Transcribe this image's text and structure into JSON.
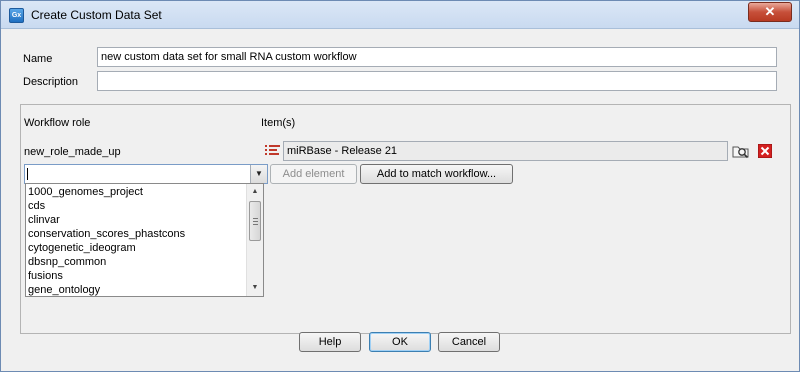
{
  "window": {
    "title": "Create Custom Data Set",
    "app_icon_text": "Gx",
    "close_symbol": "✕"
  },
  "form": {
    "name_label": "Name",
    "name_value": "new custom data set for small RNA custom workflow",
    "description_label": "Description",
    "description_value": ""
  },
  "roles": {
    "header_role": "Workflow role",
    "header_items": "Item(s)",
    "row": {
      "role": "new_role_made_up",
      "item": "miRBase - Release 21",
      "item_icon": "sequence-list-icon",
      "browse_icon": "browse-folder-icon",
      "remove_icon": "remove-icon",
      "remove_color": "#d42020"
    },
    "new_role_value": "",
    "add_element_label": "Add element",
    "add_to_match_label": "Add to match workflow...",
    "dropdown_options": [
      "1000_genomes_project",
      "cds",
      "clinvar",
      "conservation_scores_phastcons",
      "cytogenetic_ideogram",
      "dbsnp_common",
      "fusions",
      "gene_ontology"
    ]
  },
  "buttons": {
    "help": "Help",
    "ok": "OK",
    "cancel": "Cancel"
  }
}
